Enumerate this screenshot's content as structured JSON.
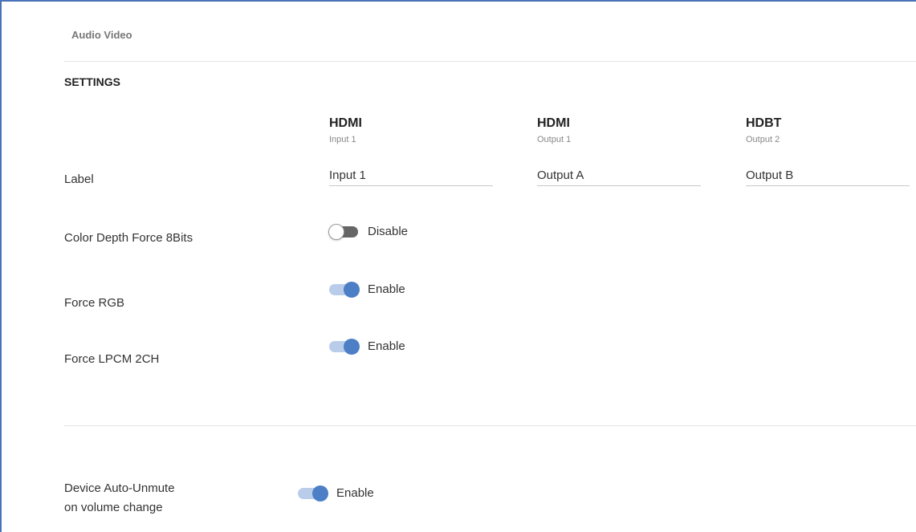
{
  "breadcrumb": "Audio Video",
  "section_title": "SETTINGS",
  "columns": [
    {
      "type": "HDMI",
      "sub": "Input 1",
      "label_value": "Input 1"
    },
    {
      "type": "HDMI",
      "sub": "Output 1",
      "label_value": "Output A"
    },
    {
      "type": "HDBT",
      "sub": "Output 2",
      "label_value": "Output B"
    }
  ],
  "rows": {
    "label": "Label",
    "color_depth": {
      "label": "Color Depth Force 8Bits",
      "state": "Disable",
      "enabled": false
    },
    "force_rgb": {
      "label": "Force RGB",
      "state": "Enable",
      "enabled": true
    },
    "force_lpcm": {
      "label": "Force LPCM 2CH",
      "state": "Enable",
      "enabled": true
    }
  },
  "device_auto_unmute": {
    "label_line1": "Device Auto-Unmute",
    "label_line2": "on volume change",
    "state": "Enable",
    "enabled": true
  },
  "colors": {
    "accent": "#4d7fc6",
    "accent_light": "#b9cdeb",
    "frame_border": "#4a72b8",
    "toggle_off_track": "#666666"
  }
}
